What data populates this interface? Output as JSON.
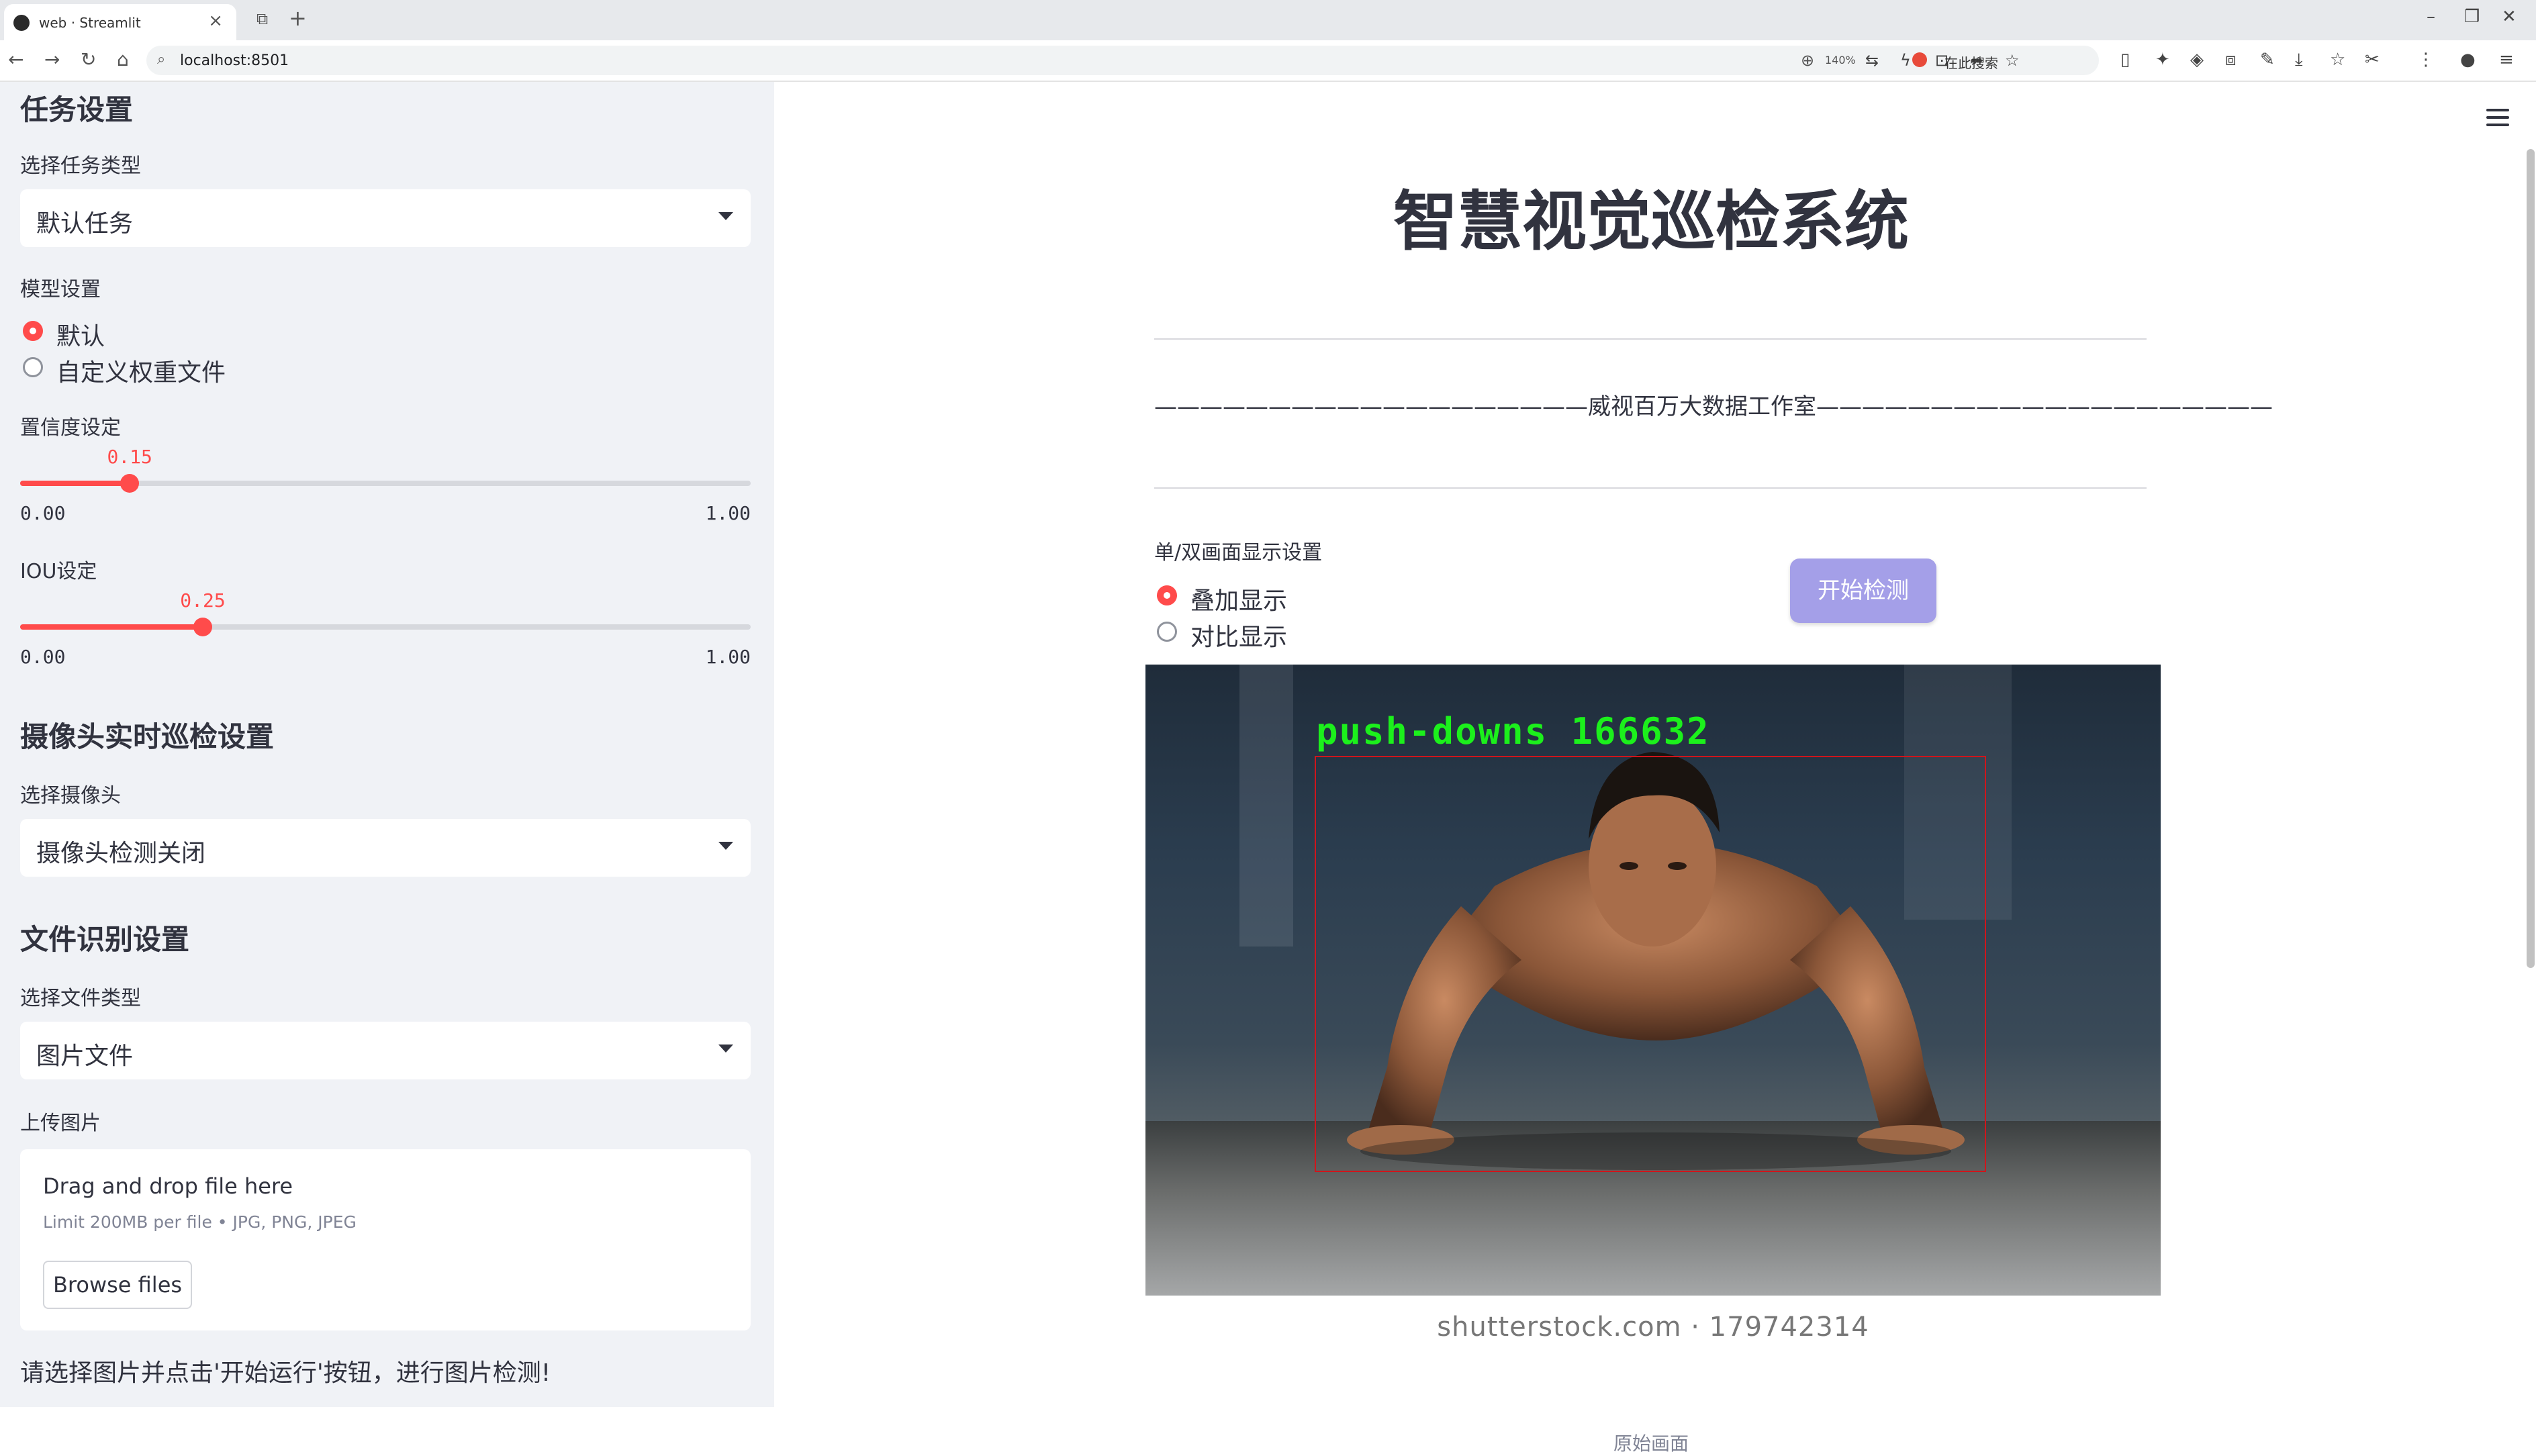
{
  "browser": {
    "tab_title": "web · Streamlit",
    "url": "localhost:8501",
    "zoom": "140%",
    "search_label": "在此搜索"
  },
  "sidebar": {
    "task_section_title": "任务设置",
    "task_type_label": "选择任务类型",
    "task_type_value": "默认任务",
    "model_label": "模型设置",
    "model_options": [
      {
        "label": "默认",
        "selected": true
      },
      {
        "label": "自定义权重文件",
        "selected": false
      }
    ],
    "confidence": {
      "label": "置信度设定",
      "value": "0.15",
      "numeric": 0.15,
      "min": "0.00",
      "max": "1.00"
    },
    "iou": {
      "label": "IOU设定",
      "value": "0.25",
      "numeric": 0.25,
      "min": "0.00",
      "max": "1.00"
    },
    "camera_section_title": "摄像头实时巡检设置",
    "camera_label": "选择摄像头",
    "camera_value": "摄像头检测关闭",
    "file_section_title": "文件识别设置",
    "file_type_label": "选择文件类型",
    "file_type_value": "图片文件",
    "upload_label": "上传图片",
    "uploader": {
      "title": "Drag and drop file here",
      "hint": "Limit 200MB per file • JPG, PNG, JPEG",
      "browse_label": "Browse files"
    },
    "instruction": "请选择图片并点击'开始运行'按钮，进行图片检测!"
  },
  "main": {
    "title": "智慧视觉巡检系统",
    "subtitle": "———————————————————威视百万大数据工作室————————————————————",
    "display_label": "单/双画面显示设置",
    "display_options": [
      {
        "label": "叠加显示",
        "selected": true
      },
      {
        "label": "对比显示",
        "selected": false
      }
    ],
    "start_button": "开始检测",
    "detection_label": "push-downs 166632",
    "watermark": "shutterstock.com · 179742314",
    "caption": "原始画面"
  },
  "colors": {
    "accent": "#ff4b4b",
    "button": "#a49fe8",
    "sidebar_bg": "#f0f2f6",
    "detection_box": "#d0151b",
    "detection_text": "#1cf01c"
  }
}
